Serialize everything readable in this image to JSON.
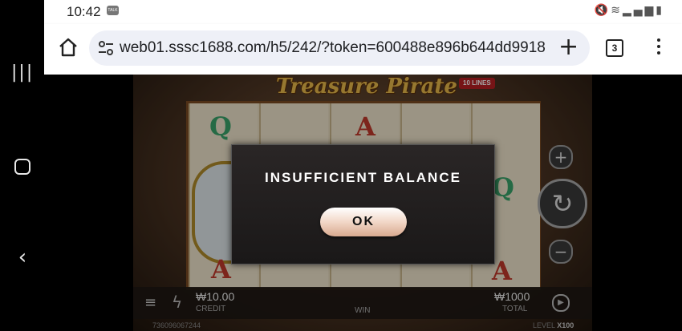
{
  "status_bar": {
    "time": "10:42",
    "notif_badge": "TALK",
    "icons": [
      "mute-icon",
      "wifi-icon",
      "signal-icon",
      "battery-icon"
    ]
  },
  "browser": {
    "url": "web01.sssc1688.com/h5/242/?token=600488e896b644dd9918",
    "tab_count": "3"
  },
  "game": {
    "title": "Treasure Pirate",
    "lines_badge": "10 LINES",
    "credit_value": "₩10.00",
    "credit_label": "CREDIT",
    "win_label": "WIN",
    "total_value": "₩1000",
    "total_label": "TOTAL",
    "game_id": "736096067244",
    "level_label": "LEVEL",
    "level_value": "X100",
    "reel_symbols": [
      "Q",
      "A",
      "Q",
      "A",
      "A",
      "A",
      "A"
    ]
  },
  "dialog": {
    "message": "INSUFFICIENT BALANCE",
    "ok_label": "OK"
  },
  "colors": {
    "accent_gold": "#e7b84a",
    "dialog_bg": "#1f1c1c",
    "ok_button": "#f2d7c7"
  }
}
